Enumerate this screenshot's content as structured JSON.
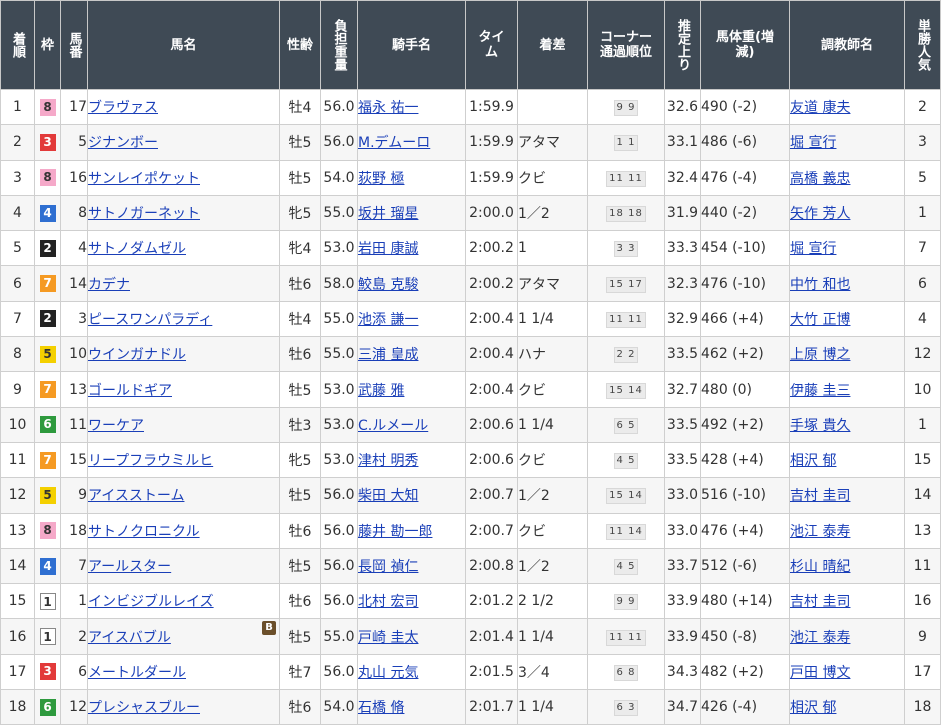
{
  "columns": {
    "rank": "着順",
    "frame": "枠",
    "number": "馬番",
    "horse": "馬名",
    "sexage": "性齢",
    "weight": "負担重量",
    "jockey": "騎手名",
    "time": "タイム",
    "margin": "着差",
    "corner": "コーナー通過順位",
    "last3f": "推定上り",
    "body_weight": "馬体重(増減)",
    "trainer": "調教師名",
    "popularity": "単勝人気"
  },
  "badge_label": "B",
  "colors": {
    "header_bg": "#3f4a55",
    "link": "#1a3fb8",
    "stripe": "#f6f6f6"
  },
  "rows": [
    {
      "rank": "1",
      "frame": "8",
      "num": "17",
      "horse": "ブラヴァス",
      "sexage": "牡4",
      "weight": "56.0",
      "jockey": "福永 祐一",
      "time": "1:59.9",
      "margin": "",
      "corner": "9 9",
      "last3f": "32.6",
      "body": "490 (-2)",
      "trainer": "友道 康夫",
      "pop": "2"
    },
    {
      "rank": "2",
      "frame": "3",
      "num": "5",
      "horse": "ジナンボー",
      "sexage": "牡5",
      "weight": "56.0",
      "jockey": "M.デムーロ",
      "time": "1:59.9",
      "margin": "アタマ",
      "corner": "1 1",
      "last3f": "33.1",
      "body": "486 (-6)",
      "trainer": "堀 宣行",
      "pop": "3"
    },
    {
      "rank": "3",
      "frame": "8",
      "num": "16",
      "horse": "サンレイポケット",
      "sexage": "牡5",
      "weight": "54.0",
      "jockey": "荻野 極",
      "time": "1:59.9",
      "margin": "クビ",
      "corner": "11 11",
      "last3f": "32.4",
      "body": "476 (-4)",
      "trainer": "高橋 義忠",
      "pop": "5"
    },
    {
      "rank": "4",
      "frame": "4",
      "num": "8",
      "horse": "サトノガーネット",
      "sexage": "牝5",
      "weight": "55.0",
      "jockey": "坂井 瑠星",
      "time": "2:00.0",
      "margin": "1／2",
      "corner": "18 18",
      "last3f": "31.9",
      "body": "440 (-2)",
      "trainer": "矢作 芳人",
      "pop": "1"
    },
    {
      "rank": "5",
      "frame": "2",
      "num": "4",
      "horse": "サトノダムゼル",
      "sexage": "牝4",
      "weight": "53.0",
      "jockey": "岩田 康誠",
      "time": "2:00.2",
      "margin": "1",
      "corner": "3 3",
      "last3f": "33.3",
      "body": "454 (-10)",
      "trainer": "堀 宣行",
      "pop": "7"
    },
    {
      "rank": "6",
      "frame": "7",
      "num": "14",
      "horse": "カデナ",
      "sexage": "牡6",
      "weight": "58.0",
      "jockey": "鮫島 克駿",
      "time": "2:00.2",
      "margin": "アタマ",
      "corner": "15 17",
      "last3f": "32.3",
      "body": "476 (-10)",
      "trainer": "中竹 和也",
      "pop": "6"
    },
    {
      "rank": "7",
      "frame": "2",
      "num": "3",
      "horse": "ピースワンパラディ",
      "sexage": "牡4",
      "weight": "55.0",
      "jockey": "池添 謙一",
      "time": "2:00.4",
      "margin": "1 1/4",
      "corner": "11 11",
      "last3f": "32.9",
      "body": "466 (+4)",
      "trainer": "大竹 正博",
      "pop": "4"
    },
    {
      "rank": "8",
      "frame": "5",
      "num": "10",
      "horse": "ウインガナドル",
      "sexage": "牡6",
      "weight": "55.0",
      "jockey": "三浦 皇成",
      "time": "2:00.4",
      "margin": "ハナ",
      "corner": "2 2",
      "last3f": "33.5",
      "body": "462 (+2)",
      "trainer": "上原 博之",
      "pop": "12"
    },
    {
      "rank": "9",
      "frame": "7",
      "num": "13",
      "horse": "ゴールドギア",
      "sexage": "牡5",
      "weight": "53.0",
      "jockey": "武藤 雅",
      "time": "2:00.4",
      "margin": "クビ",
      "corner": "15 14",
      "last3f": "32.7",
      "body": "480 (0)",
      "trainer": "伊藤 圭三",
      "pop": "10"
    },
    {
      "rank": "10",
      "frame": "6",
      "num": "11",
      "horse": "ワーケア",
      "sexage": "牡3",
      "weight": "53.0",
      "jockey": "C.ルメール",
      "time": "2:00.6",
      "margin": "1 1/4",
      "corner": "6 5",
      "last3f": "33.5",
      "body": "492 (+2)",
      "trainer": "手塚 貴久",
      "pop": "1"
    },
    {
      "rank": "11",
      "frame": "7",
      "num": "15",
      "horse": "リープフラウミルヒ",
      "sexage": "牝5",
      "weight": "53.0",
      "jockey": "津村 明秀",
      "time": "2:00.6",
      "margin": "クビ",
      "corner": "4 5",
      "last3f": "33.5",
      "body": "428 (+4)",
      "trainer": "相沢 郁",
      "pop": "15"
    },
    {
      "rank": "12",
      "frame": "5",
      "num": "9",
      "horse": "アイスストーム",
      "sexage": "牡5",
      "weight": "56.0",
      "jockey": "柴田 大知",
      "time": "2:00.7",
      "margin": "1／2",
      "corner": "15 14",
      "last3f": "33.0",
      "body": "516 (-10)",
      "trainer": "吉村 圭司",
      "pop": "14"
    },
    {
      "rank": "13",
      "frame": "8",
      "num": "18",
      "horse": "サトノクロニクル",
      "sexage": "牡6",
      "weight": "56.0",
      "jockey": "藤井 勘一郎",
      "time": "2:00.7",
      "margin": "クビ",
      "corner": "11 14",
      "last3f": "33.0",
      "body": "476 (+4)",
      "trainer": "池江 泰寿",
      "pop": "13"
    },
    {
      "rank": "14",
      "frame": "4",
      "num": "7",
      "horse": "アールスター",
      "sexage": "牡5",
      "weight": "56.0",
      "jockey": "長岡 禎仁",
      "time": "2:00.8",
      "margin": "1／2",
      "corner": "4 5",
      "last3f": "33.7",
      "body": "512 (-6)",
      "trainer": "杉山 晴紀",
      "pop": "11"
    },
    {
      "rank": "15",
      "frame": "1",
      "num": "1",
      "horse": "インビジブルレイズ",
      "sexage": "牡6",
      "weight": "56.0",
      "jockey": "北村 宏司",
      "time": "2:01.2",
      "margin": "2 1/2",
      "corner": "9 9",
      "last3f": "33.9",
      "body": "480 (+14)",
      "trainer": "吉村 圭司",
      "pop": "16"
    },
    {
      "rank": "16",
      "frame": "1",
      "num": "2",
      "horse": "アイスバブル",
      "sexage": "牡5",
      "weight": "55.0",
      "jockey": "戸崎 圭太",
      "time": "2:01.4",
      "margin": "1 1/4",
      "corner": "11 11",
      "last3f": "33.9",
      "body": "450 (-8)",
      "trainer": "池江 泰寿",
      "pop": "9",
      "blinker": true
    },
    {
      "rank": "17",
      "frame": "3",
      "num": "6",
      "horse": "メートルダール",
      "sexage": "牡7",
      "weight": "56.0",
      "jockey": "丸山 元気",
      "time": "2:01.5",
      "margin": "3／4",
      "corner": "6 8",
      "last3f": "34.3",
      "body": "482 (+2)",
      "trainer": "戸田 博文",
      "pop": "17"
    },
    {
      "rank": "18",
      "frame": "6",
      "num": "12",
      "horse": "プレシャスブルー",
      "sexage": "牡6",
      "weight": "54.0",
      "jockey": "石橋 脩",
      "time": "2:01.7",
      "margin": "1 1/4",
      "corner": "6 3",
      "last3f": "34.7",
      "body": "426 (-4)",
      "trainer": "相沢 郁",
      "pop": "18"
    }
  ]
}
